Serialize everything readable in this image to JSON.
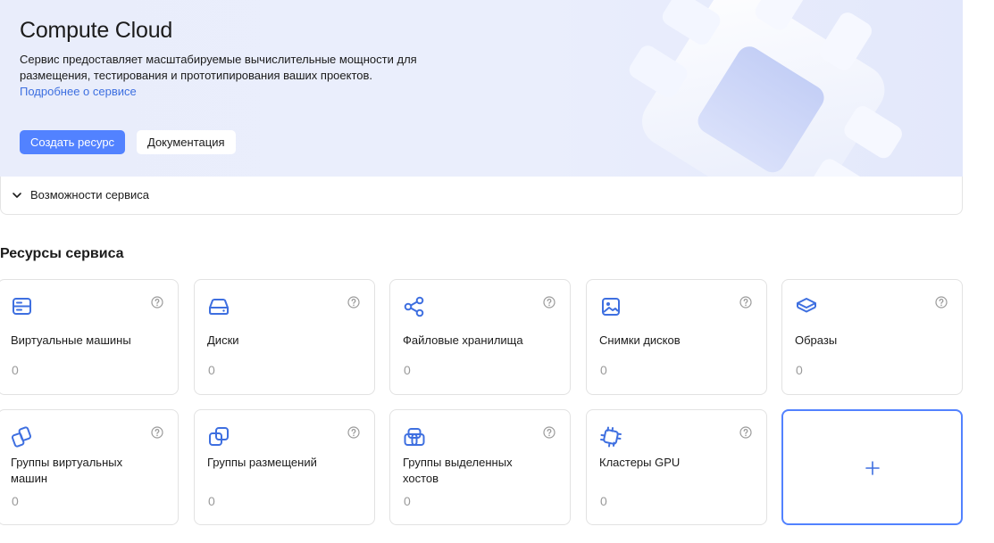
{
  "hero": {
    "title": "Compute Cloud",
    "description": "Сервис предоставляет масштабируемые вычислительные мощности для размещения, тестирования и прототипирования ваших проектов.",
    "link": "Подробнее о сервисе",
    "primary_button": "Создать ресурс",
    "secondary_button": "Документация"
  },
  "features": {
    "label": "Возможности сервиса"
  },
  "resources": {
    "title": "Ресурсы сервиса",
    "cards": [
      {
        "name": "Виртуальные машины",
        "count": "0",
        "icon": "server-icon"
      },
      {
        "name": "Диски",
        "count": "0",
        "icon": "disk-icon"
      },
      {
        "name": "Файловые хранилища",
        "count": "0",
        "icon": "share-nodes-icon"
      },
      {
        "name": "Снимки дисков",
        "count": "0",
        "icon": "image-icon"
      },
      {
        "name": "Образы",
        "count": "0",
        "icon": "layers-icon"
      },
      {
        "name": "Группы виртуальных машин",
        "count": "0",
        "icon": "vm-group-icon"
      },
      {
        "name": "Группы размещений",
        "count": "0",
        "icon": "placement-group-icon"
      },
      {
        "name": "Группы выделенных хостов",
        "count": "0",
        "icon": "host-group-icon"
      },
      {
        "name": "Кластеры GPU",
        "count": "0",
        "icon": "gpu-chip-icon"
      }
    ]
  },
  "colors": {
    "accent": "#5282ff",
    "link": "#3d6fe0",
    "icon": "#3e6fe0"
  }
}
